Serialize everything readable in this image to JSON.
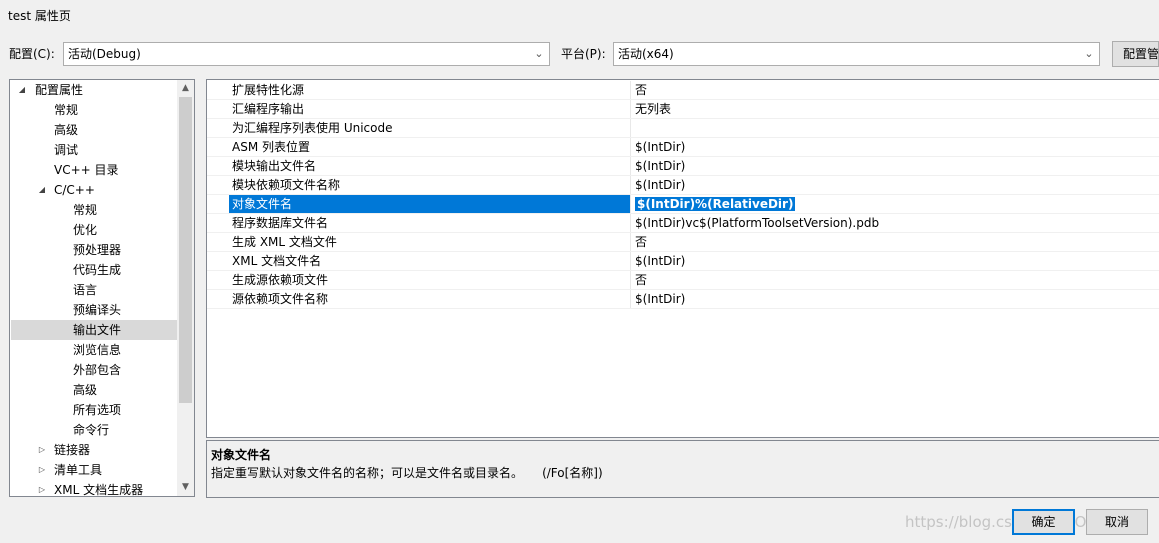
{
  "window": {
    "title": "test 属性页"
  },
  "toolbar": {
    "config_label": "配置(C):",
    "config_value": "活动(Debug)",
    "platform_label": "平台(P):",
    "platform_value": "活动(x64)",
    "config_manager_label": "配置管"
  },
  "tree": {
    "items": [
      {
        "label": "配置属性",
        "expander": "◢"
      },
      {
        "label": "常规",
        "expander": ""
      },
      {
        "label": "高级",
        "expander": ""
      },
      {
        "label": "调试",
        "expander": ""
      },
      {
        "label": "VC++ 目录",
        "expander": ""
      },
      {
        "label": "C/C++",
        "expander": "◢"
      },
      {
        "label": "常规",
        "expander": ""
      },
      {
        "label": "优化",
        "expander": ""
      },
      {
        "label": "预处理器",
        "expander": ""
      },
      {
        "label": "代码生成",
        "expander": ""
      },
      {
        "label": "语言",
        "expander": ""
      },
      {
        "label": "预编译头",
        "expander": ""
      },
      {
        "label": "输出文件",
        "expander": ""
      },
      {
        "label": "浏览信息",
        "expander": ""
      },
      {
        "label": "外部包含",
        "expander": ""
      },
      {
        "label": "高级",
        "expander": ""
      },
      {
        "label": "所有选项",
        "expander": ""
      },
      {
        "label": "命令行",
        "expander": ""
      },
      {
        "label": "链接器",
        "expander": "▷"
      },
      {
        "label": "清单工具",
        "expander": "▷"
      },
      {
        "label": "XML 文档生成器",
        "expander": "▷"
      }
    ],
    "selected_index": 12
  },
  "grid": {
    "rows": [
      {
        "name": "扩展特性化源",
        "value": "否"
      },
      {
        "name": "汇编程序输出",
        "value": "无列表"
      },
      {
        "name": "为汇编程序列表使用 Unicode",
        "value": ""
      },
      {
        "name": "ASM 列表位置",
        "value": "$(IntDir)"
      },
      {
        "name": "模块输出文件名",
        "value": "$(IntDir)"
      },
      {
        "name": "模块依赖项文件名称",
        "value": "$(IntDir)"
      },
      {
        "name": "对象文件名",
        "value": "$(IntDir)%(RelativeDir)"
      },
      {
        "name": "程序数据库文件名",
        "value": "$(IntDir)vc$(PlatformToolsetVersion).pdb"
      },
      {
        "name": "生成 XML 文档文件",
        "value": "否"
      },
      {
        "name": "XML 文档文件名",
        "value": "$(IntDir)"
      },
      {
        "name": "生成源依赖项文件",
        "value": "否"
      },
      {
        "name": "源依赖项文件名称",
        "value": "$(IntDir)"
      }
    ],
    "selected_index": 6
  },
  "description": {
    "title": "对象文件名",
    "text": "指定重写默认对象文件名的名称；可以是文件名或目录名。     (/Fo[名称])"
  },
  "buttons": {
    "ok": "确定",
    "cancel": "取消"
  },
  "watermark": "https://blog.csdn.net/TORANGE",
  "icons": {
    "combo_arrow": "chevron-down-icon",
    "scroll_up": "scroll-up-icon",
    "scroll_down": "scroll-down-icon"
  },
  "colors": {
    "selection": "#0078d7",
    "tree_selection": "#d9d9d9"
  }
}
